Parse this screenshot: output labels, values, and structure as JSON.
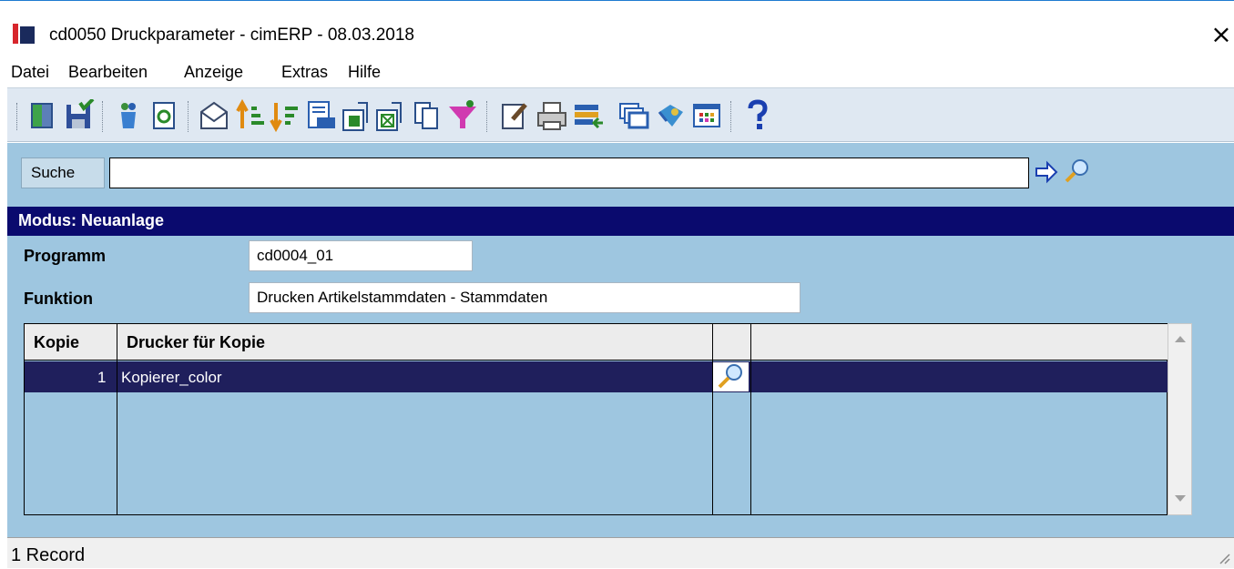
{
  "window": {
    "title": "cd0050 Druckparameter - cimERP - 08.03.2018",
    "close_glyph": "×"
  },
  "menu": {
    "items": [
      "Datei",
      "Bearbeiten",
      "Anzeige",
      "Extras",
      "Hilfe"
    ]
  },
  "toolbar": {
    "icons": [
      "exit-door-icon",
      "save-icon",
      "recycle-icon",
      "refresh-icon",
      "mail-icon",
      "sort-ascending-icon",
      "sort-descending-icon",
      "number-list-icon",
      "export-icon",
      "excel-icon",
      "copy-icon",
      "filter-icon",
      "edit-doc-icon",
      "print-icon",
      "transfer-icon",
      "windows-icon",
      "book-icon",
      "grid-icon",
      "help-icon"
    ]
  },
  "search": {
    "label": "Suche",
    "value": ""
  },
  "mode": {
    "text": "Modus: Neuanlage"
  },
  "fields": {
    "programm_label": "Programm",
    "programm_value": "cd0004_01",
    "funktion_label": "Funktion",
    "funktion_value": "Drucken Artikelstammdaten - Stammdaten"
  },
  "grid": {
    "headers": [
      "Kopie",
      "Drucker für Kopie",
      "",
      ""
    ],
    "rows": [
      {
        "kopie": "1",
        "drucker": "Kopierer_color"
      }
    ]
  },
  "status": {
    "text": "1 Record"
  },
  "colors": {
    "mode_bar": "#0a0a6e",
    "panel": "#9ec6e0",
    "selected_row": "#1f1f5c"
  }
}
